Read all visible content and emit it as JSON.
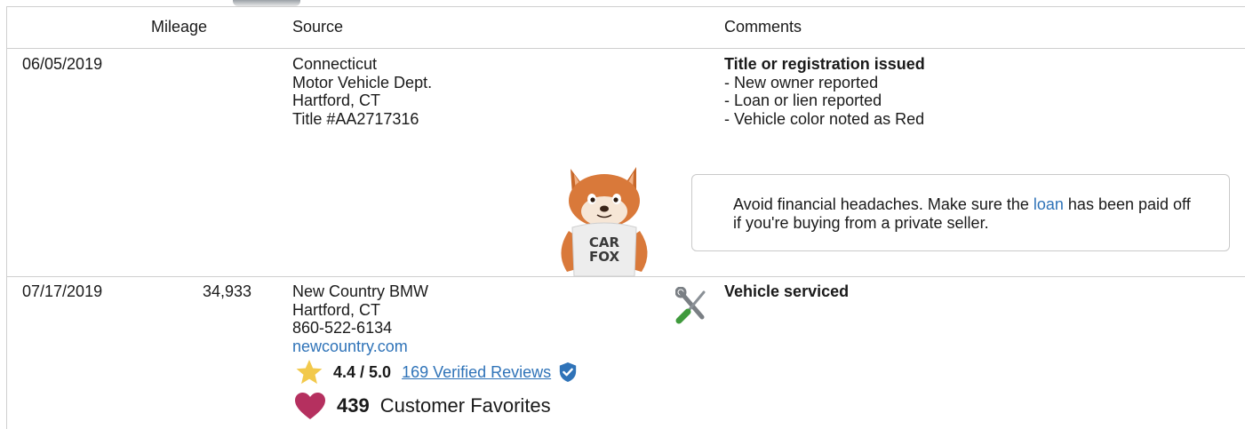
{
  "headers": {
    "mileage": "Mileage",
    "source": "Source",
    "comments": "Comments"
  },
  "records": [
    {
      "date": "06/05/2019",
      "mileage": "",
      "source": [
        "Connecticut",
        "Motor Vehicle Dept.",
        "Hartford, CT",
        "Title #AA2717316"
      ],
      "comment_title": "Title or registration issued",
      "comment_items": [
        "- New owner reported",
        "- Loan or lien reported",
        "- Vehicle color noted as Red"
      ]
    },
    {
      "date": "07/17/2019",
      "mileage": "34,933",
      "source": [
        "New Country BMW",
        "Hartford, CT",
        "860-522-6134"
      ],
      "source_link": "newcountry.com",
      "comment_title": "Vehicle serviced",
      "rating": "4.4 / 5.0",
      "reviews_link": "169 Verified Reviews",
      "favorites_count": "439",
      "favorites_label": "Customer Favorites"
    }
  ],
  "tip": {
    "before": "Avoid financial headaches. Make sure the ",
    "link": "loan",
    "after": " has been paid off if you're buying from a private seller."
  },
  "mascot": {
    "shirt_line1": "CAR",
    "shirt_line2": "FOX"
  },
  "icons": {
    "service": "wrench-screwdriver-icon",
    "rating": "star-icon",
    "verified": "verified-badge-icon",
    "favorite": "heart-icon"
  },
  "colors": {
    "link": "#2f73b8",
    "star": "#f2c94c",
    "heart": "#b5305f",
    "badge": "#2f73b8",
    "rule": "#cfcfcf"
  }
}
